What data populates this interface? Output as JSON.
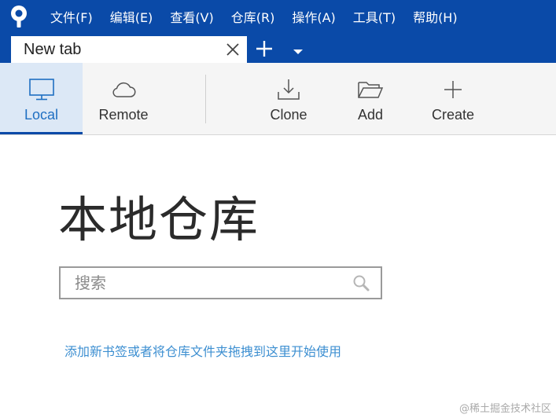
{
  "menu": {
    "items": [
      {
        "label": "文件(F)"
      },
      {
        "label": "编辑(E)"
      },
      {
        "label": "查看(V)"
      },
      {
        "label": "仓库(R)"
      },
      {
        "label": "操作(A)"
      },
      {
        "label": "工具(T)"
      },
      {
        "label": "帮助(H)"
      }
    ]
  },
  "tabs": {
    "active_title": "New tab"
  },
  "toolbar": {
    "local_label": "Local",
    "remote_label": "Remote",
    "clone_label": "Clone",
    "add_label": "Add",
    "create_label": "Create"
  },
  "main": {
    "title": "本地仓库",
    "search_placeholder": "搜索",
    "hint_link": "添加新书签或者将仓库文件夹拖拽到这里开始使用"
  },
  "watermark": "@稀土掘金技术社区",
  "colors": {
    "brand": "#0a4aa8",
    "active_tab_bg": "#dce8f6",
    "link": "#3d8fd1"
  },
  "icons": {
    "app": "sourcetree-logo-icon",
    "local": "monitor-icon",
    "remote": "cloud-icon",
    "clone": "download-icon",
    "add": "folder-open-icon",
    "create": "plus-icon",
    "search": "search-icon"
  }
}
